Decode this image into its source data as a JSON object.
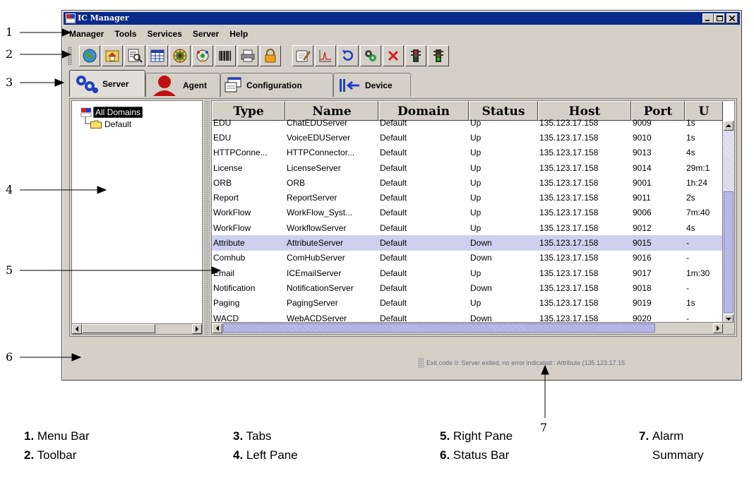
{
  "window": {
    "title": "IC Manager",
    "controls": [
      "minimize",
      "maximize",
      "close"
    ]
  },
  "menubar": [
    "Manager",
    "Tools",
    "Services",
    "Server",
    "Help"
  ],
  "toolbar": {
    "icons": [
      "globe-icon",
      "home-icon",
      "find-icon",
      "table-icon",
      "dartboard-icon",
      "barcode-icon",
      "printer-icon",
      "lock-icon",
      "edit-icon",
      "chart-icon",
      "refresh-icon",
      "view-icon",
      "delete-icon",
      "traffic-light-red-icon",
      "traffic-light-green-icon"
    ]
  },
  "tabs": [
    {
      "label": "Server",
      "icon": "gears-icon",
      "active": true
    },
    {
      "label": "Agent",
      "icon": "agent-icon",
      "active": false
    },
    {
      "label": "Configuration",
      "icon": "configuration-icon",
      "active": false
    },
    {
      "label": "Device",
      "icon": "device-icon",
      "active": false
    }
  ],
  "tree": {
    "root": "All Domains",
    "child": "Default"
  },
  "table": {
    "columns": [
      "Type",
      "Name",
      "Domain",
      "Status",
      "Host",
      "Port",
      "U"
    ],
    "rows": [
      [
        "EDU",
        "ChatEDUServer",
        "Default",
        "Up",
        "135.123.17.158",
        "9009",
        "1s"
      ],
      [
        "EDU",
        "VoiceEDUServer",
        "Default",
        "Up",
        "135.123.17.158",
        "9010",
        "1s"
      ],
      [
        "HTTPConne...",
        "HTTPConnector...",
        "Default",
        "Up",
        "135.123.17.158",
        "9013",
        "4s"
      ],
      [
        "License",
        "LicenseServer",
        "Default",
        "Up",
        "135.123.17.158",
        "9014",
        "29m:1"
      ],
      [
        "ORB",
        "ORB",
        "Default",
        "Up",
        "135.123.17.158",
        "9001",
        "1h:24"
      ],
      [
        "Report",
        "ReportServer",
        "Default",
        "Up",
        "135.123.17.158",
        "9011",
        "2s"
      ],
      [
        "WorkFlow",
        "WorkFlow_Syst...",
        "Default",
        "Up",
        "135.123.17.158",
        "9006",
        "7m:40"
      ],
      [
        "WorkFlow",
        "WorkflowServer",
        "Default",
        "Up",
        "135.123.17.158",
        "9012",
        "4s"
      ],
      [
        "Attribute",
        "AttributeServer",
        "Default",
        "Down",
        "135.123.17.158",
        "9015",
        "-"
      ],
      [
        "Comhub",
        "ComHubServer",
        "Default",
        "Down",
        "135.123.17.158",
        "9016",
        "-"
      ],
      [
        "Email",
        "ICEmailServer",
        "Default",
        "Up",
        "135.123.17.158",
        "9017",
        "1m:30"
      ],
      [
        "Notification",
        "NotificationServer",
        "Default",
        "Down",
        "135.123.17.158",
        "9018",
        "-"
      ],
      [
        "Paging",
        "PagingServer",
        "Default",
        "Up",
        "135.123.17.158",
        "9019",
        "1s"
      ],
      [
        "WACD",
        "WebACDServer",
        "Default",
        "Down",
        "135.123.17.158",
        "9020",
        "-"
      ]
    ],
    "selected_row": 8
  },
  "status": {
    "alarm_summary": "Exit code 0: Server exited, no error indicated:: Attribute (135.123.17.15"
  },
  "callouts": [
    "1",
    "2",
    "3",
    "4",
    "5",
    "6",
    "7"
  ],
  "legend": [
    {
      "num": "1.",
      "label": "Menu Bar"
    },
    {
      "num": "2.",
      "label": "Toolbar"
    },
    {
      "num": "3.",
      "label": "Tabs"
    },
    {
      "num": "4.",
      "label": "Left Pane"
    },
    {
      "num": "5.",
      "label": "Right Pane"
    },
    {
      "num": "6.",
      "label": "Status Bar"
    },
    {
      "num": "7.",
      "label": "Alarm Summary"
    }
  ]
}
